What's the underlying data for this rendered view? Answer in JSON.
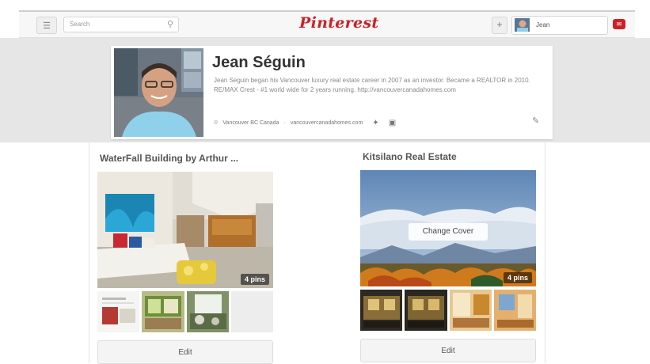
{
  "header": {
    "search_placeholder": "Search",
    "logo_text": "Pinterest",
    "add_label": "+",
    "user_name": "Jean",
    "brand_color": "#cc2127"
  },
  "profile": {
    "name": "Jean Séguin",
    "bio": "Jean Seguin began his Vancouver luxury real estate career in 2007 as an investor. Became a REALTOR in 2010. RE/MAX Crest - #1 world wide for 2 years running. http://vancouvercanadahomes.com",
    "location": "Vancouver BC Canada",
    "website": "vancouvercanadahomes.com"
  },
  "boards": [
    {
      "title": "WaterFall Building by Arthur ...",
      "pins": "4 pins",
      "edit_label": "Edit"
    },
    {
      "title": "Kitsilano Real Estate",
      "pins": "4 pins",
      "change_cover_label": "Change Cover",
      "edit_label": "Edit"
    }
  ]
}
